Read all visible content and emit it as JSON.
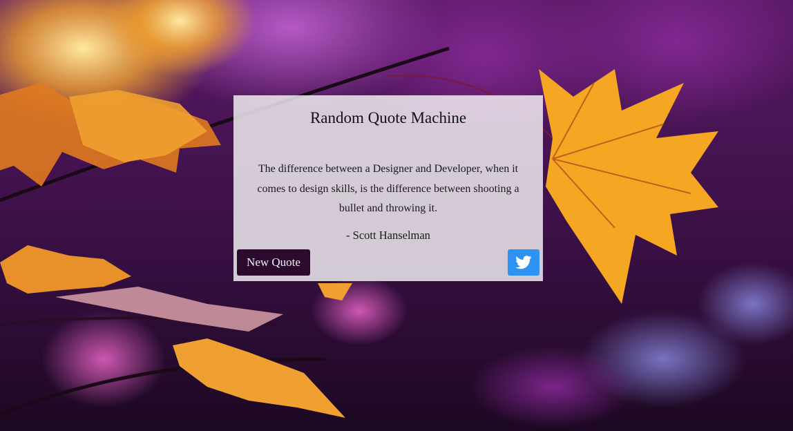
{
  "app": {
    "title": "Random Quote Machine"
  },
  "quote": {
    "text": "The difference between a Designer and Developer, when it comes to design skills, is the difference between shooting a bullet and throwing it.",
    "author": "- Scott Hanselman"
  },
  "actions": {
    "new_quote_label": "New Quote",
    "tweet_icon": "twitter-icon"
  },
  "colors": {
    "button_dark": "#2b0a2e",
    "twitter_blue": "#2c93f2",
    "background_purple": "#4a1550",
    "leaf_orange": "#f5a623"
  }
}
